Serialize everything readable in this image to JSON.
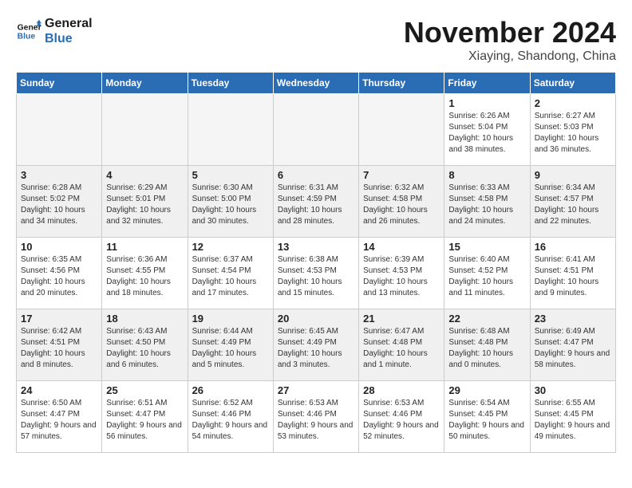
{
  "header": {
    "logo_line1": "General",
    "logo_line2": "Blue",
    "month": "November 2024",
    "location": "Xiaying, Shandong, China"
  },
  "weekdays": [
    "Sunday",
    "Monday",
    "Tuesday",
    "Wednesday",
    "Thursday",
    "Friday",
    "Saturday"
  ],
  "weeks": [
    [
      {
        "day": "",
        "content": "",
        "empty": true
      },
      {
        "day": "",
        "content": "",
        "empty": true
      },
      {
        "day": "",
        "content": "",
        "empty": true
      },
      {
        "day": "",
        "content": "",
        "empty": true
      },
      {
        "day": "",
        "content": "",
        "empty": true
      },
      {
        "day": "1",
        "content": "Sunrise: 6:26 AM\nSunset: 5:04 PM\nDaylight: 10 hours and 38 minutes."
      },
      {
        "day": "2",
        "content": "Sunrise: 6:27 AM\nSunset: 5:03 PM\nDaylight: 10 hours and 36 minutes."
      }
    ],
    [
      {
        "day": "3",
        "content": "Sunrise: 6:28 AM\nSunset: 5:02 PM\nDaylight: 10 hours and 34 minutes."
      },
      {
        "day": "4",
        "content": "Sunrise: 6:29 AM\nSunset: 5:01 PM\nDaylight: 10 hours and 32 minutes."
      },
      {
        "day": "5",
        "content": "Sunrise: 6:30 AM\nSunset: 5:00 PM\nDaylight: 10 hours and 30 minutes."
      },
      {
        "day": "6",
        "content": "Sunrise: 6:31 AM\nSunset: 4:59 PM\nDaylight: 10 hours and 28 minutes."
      },
      {
        "day": "7",
        "content": "Sunrise: 6:32 AM\nSunset: 4:58 PM\nDaylight: 10 hours and 26 minutes."
      },
      {
        "day": "8",
        "content": "Sunrise: 6:33 AM\nSunset: 4:58 PM\nDaylight: 10 hours and 24 minutes."
      },
      {
        "day": "9",
        "content": "Sunrise: 6:34 AM\nSunset: 4:57 PM\nDaylight: 10 hours and 22 minutes."
      }
    ],
    [
      {
        "day": "10",
        "content": "Sunrise: 6:35 AM\nSunset: 4:56 PM\nDaylight: 10 hours and 20 minutes."
      },
      {
        "day": "11",
        "content": "Sunrise: 6:36 AM\nSunset: 4:55 PM\nDaylight: 10 hours and 18 minutes."
      },
      {
        "day": "12",
        "content": "Sunrise: 6:37 AM\nSunset: 4:54 PM\nDaylight: 10 hours and 17 minutes."
      },
      {
        "day": "13",
        "content": "Sunrise: 6:38 AM\nSunset: 4:53 PM\nDaylight: 10 hours and 15 minutes."
      },
      {
        "day": "14",
        "content": "Sunrise: 6:39 AM\nSunset: 4:53 PM\nDaylight: 10 hours and 13 minutes."
      },
      {
        "day": "15",
        "content": "Sunrise: 6:40 AM\nSunset: 4:52 PM\nDaylight: 10 hours and 11 minutes."
      },
      {
        "day": "16",
        "content": "Sunrise: 6:41 AM\nSunset: 4:51 PM\nDaylight: 10 hours and 9 minutes."
      }
    ],
    [
      {
        "day": "17",
        "content": "Sunrise: 6:42 AM\nSunset: 4:51 PM\nDaylight: 10 hours and 8 minutes."
      },
      {
        "day": "18",
        "content": "Sunrise: 6:43 AM\nSunset: 4:50 PM\nDaylight: 10 hours and 6 minutes."
      },
      {
        "day": "19",
        "content": "Sunrise: 6:44 AM\nSunset: 4:49 PM\nDaylight: 10 hours and 5 minutes."
      },
      {
        "day": "20",
        "content": "Sunrise: 6:45 AM\nSunset: 4:49 PM\nDaylight: 10 hours and 3 minutes."
      },
      {
        "day": "21",
        "content": "Sunrise: 6:47 AM\nSunset: 4:48 PM\nDaylight: 10 hours and 1 minute."
      },
      {
        "day": "22",
        "content": "Sunrise: 6:48 AM\nSunset: 4:48 PM\nDaylight: 10 hours and 0 minutes."
      },
      {
        "day": "23",
        "content": "Sunrise: 6:49 AM\nSunset: 4:47 PM\nDaylight: 9 hours and 58 minutes."
      }
    ],
    [
      {
        "day": "24",
        "content": "Sunrise: 6:50 AM\nSunset: 4:47 PM\nDaylight: 9 hours and 57 minutes."
      },
      {
        "day": "25",
        "content": "Sunrise: 6:51 AM\nSunset: 4:47 PM\nDaylight: 9 hours and 56 minutes."
      },
      {
        "day": "26",
        "content": "Sunrise: 6:52 AM\nSunset: 4:46 PM\nDaylight: 9 hours and 54 minutes."
      },
      {
        "day": "27",
        "content": "Sunrise: 6:53 AM\nSunset: 4:46 PM\nDaylight: 9 hours and 53 minutes."
      },
      {
        "day": "28",
        "content": "Sunrise: 6:53 AM\nSunset: 4:46 PM\nDaylight: 9 hours and 52 minutes."
      },
      {
        "day": "29",
        "content": "Sunrise: 6:54 AM\nSunset: 4:45 PM\nDaylight: 9 hours and 50 minutes."
      },
      {
        "day": "30",
        "content": "Sunrise: 6:55 AM\nSunset: 4:45 PM\nDaylight: 9 hours and 49 minutes."
      }
    ]
  ]
}
